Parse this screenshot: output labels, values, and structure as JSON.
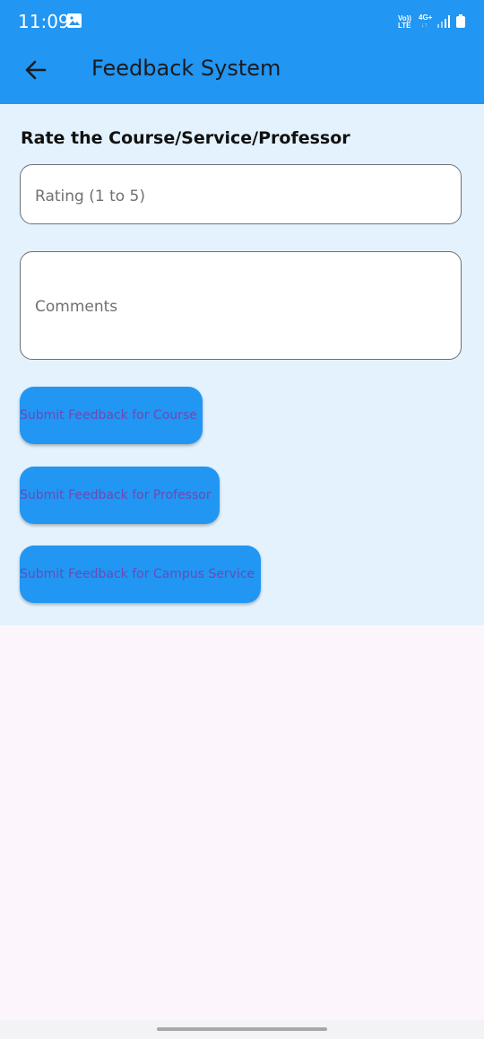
{
  "status_bar": {
    "time": "11:09",
    "volte_line1": "Vo))",
    "volte_line2": "LTE",
    "network": "4G+",
    "network_arrows": "↓↑",
    "icons": [
      "gallery-icon",
      "signal-icon",
      "battery-icon"
    ]
  },
  "app_bar": {
    "title": "Feedback System",
    "back_icon": "arrow-back-icon"
  },
  "form": {
    "section_title": "Rate the Course/Service/Professor",
    "rating_placeholder": "Rating (1 to 5)",
    "rating_value": "",
    "comments_placeholder": "Comments",
    "comments_value": ""
  },
  "buttons": {
    "course": "Submit Feedback for Course",
    "professor": "Submit Feedback for Professor",
    "campus_service": "Submit Feedback for Campus Service"
  },
  "colors": {
    "primary": "#2196f3",
    "content_background": "#e3f2fd",
    "page_background": "#fcf6fc",
    "button_text": "#6a4bb5"
  }
}
